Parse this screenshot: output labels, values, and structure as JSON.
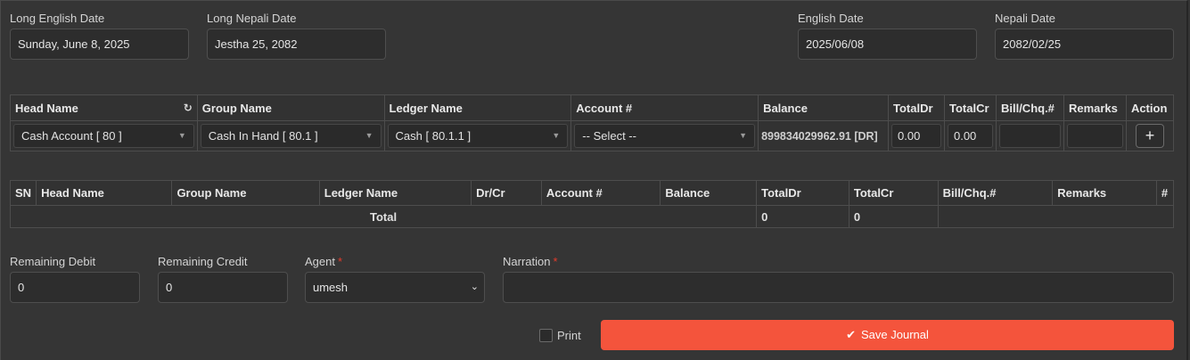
{
  "dates": {
    "long_english_label": "Long English Date",
    "long_english_value": "Sunday, June 8, 2025",
    "long_nepali_label": "Long Nepali Date",
    "long_nepali_value": "Jestha 25, 2082",
    "english_label": "English Date",
    "english_value": "2025/06/08",
    "nepali_label": "Nepali Date",
    "nepali_value": "2082/02/25"
  },
  "entry_table": {
    "headers": [
      "Head Name",
      "Group Name",
      "Ledger Name",
      "Account #",
      "Balance",
      "TotalDr",
      "TotalCr",
      "Bill/Chq.#",
      "Remarks",
      "Action"
    ],
    "head_select": "Cash Account [ 80 ]",
    "group_select": "Cash In Hand [ 80.1 ]",
    "ledger_select": "Cash [ 80.1.1 ]",
    "account_select": "-- Select --",
    "balance": "899834029962.91 [DR]",
    "total_dr": "0.00",
    "total_cr": "0.00",
    "refresh_icon": "refresh-icon",
    "add_icon": "+"
  },
  "list_table": {
    "headers": [
      "SN",
      "Head Name",
      "Group Name",
      "Ledger Name",
      "Dr/Cr",
      "Account #",
      "Balance",
      "TotalDr",
      "TotalCr",
      "Bill/Chq.#",
      "Remarks",
      "#"
    ],
    "total_label": "Total",
    "total_dr": "0",
    "total_cr": "0"
  },
  "footer": {
    "remaining_debit_label": "Remaining Debit",
    "remaining_debit_value": "0",
    "remaining_credit_label": "Remaining Credit",
    "remaining_credit_value": "0",
    "agent_label": "Agent",
    "agent_value": "umesh",
    "narration_label": "Narration",
    "required_mark": "*",
    "print_label": "Print",
    "save_label": "Save Journal"
  },
  "colors": {
    "accent": "#f4543c",
    "required": "#e53b2c",
    "background": "#353535"
  }
}
